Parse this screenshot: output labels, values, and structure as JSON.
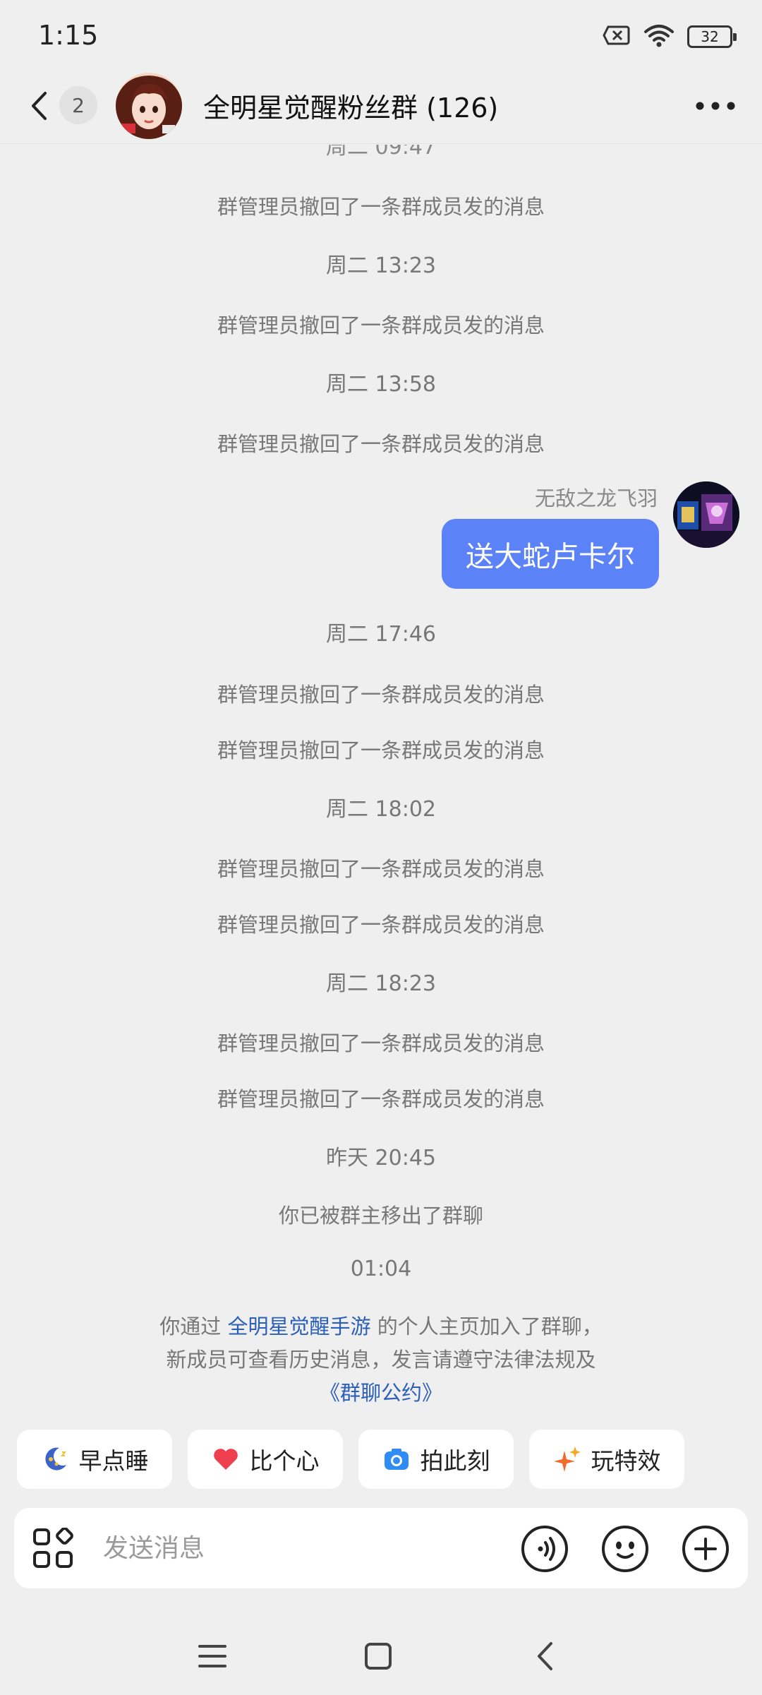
{
  "status_bar": {
    "time": "1:15",
    "battery": "32"
  },
  "header": {
    "unread_count": "2",
    "group_title": "全明星觉醒粉丝群 (126)"
  },
  "chat": {
    "partial_top_time": "周二 09:47",
    "recall_text": "群管理员撤回了一条群成员发的消息",
    "times": {
      "t1": "周二 13:23",
      "t2": "周二 13:58",
      "t3": "周二 17:46",
      "t4": "周二 18:02",
      "t5": "周二 18:23",
      "t6": "昨天 20:45",
      "t7": "01:04"
    },
    "outgoing": {
      "sender_name": "无敌之龙飞羽",
      "text": "送大蛇卢卡尔"
    },
    "removed_notice": "你已被群主移出了群聊",
    "join_notice": {
      "prefix": "你通过",
      "link_name": "全明星觉醒手游",
      "middle": "的个人主页加入了群聊，新成员可查看历史消息，发言请遵守法律法规及",
      "rules_link": "《群聊公约》"
    }
  },
  "quick_actions": [
    {
      "label": "早点睡",
      "icon": "moon-sleep-icon"
    },
    {
      "label": "比个心",
      "icon": "heart-icon"
    },
    {
      "label": "拍此刻",
      "icon": "camera-icon"
    },
    {
      "label": "玩特效",
      "icon": "sparkle-icon"
    }
  ],
  "input": {
    "placeholder": "发送消息"
  },
  "colors": {
    "bubble": "#5b82f6",
    "link": "#2b5fb8",
    "background": "#efefef"
  }
}
